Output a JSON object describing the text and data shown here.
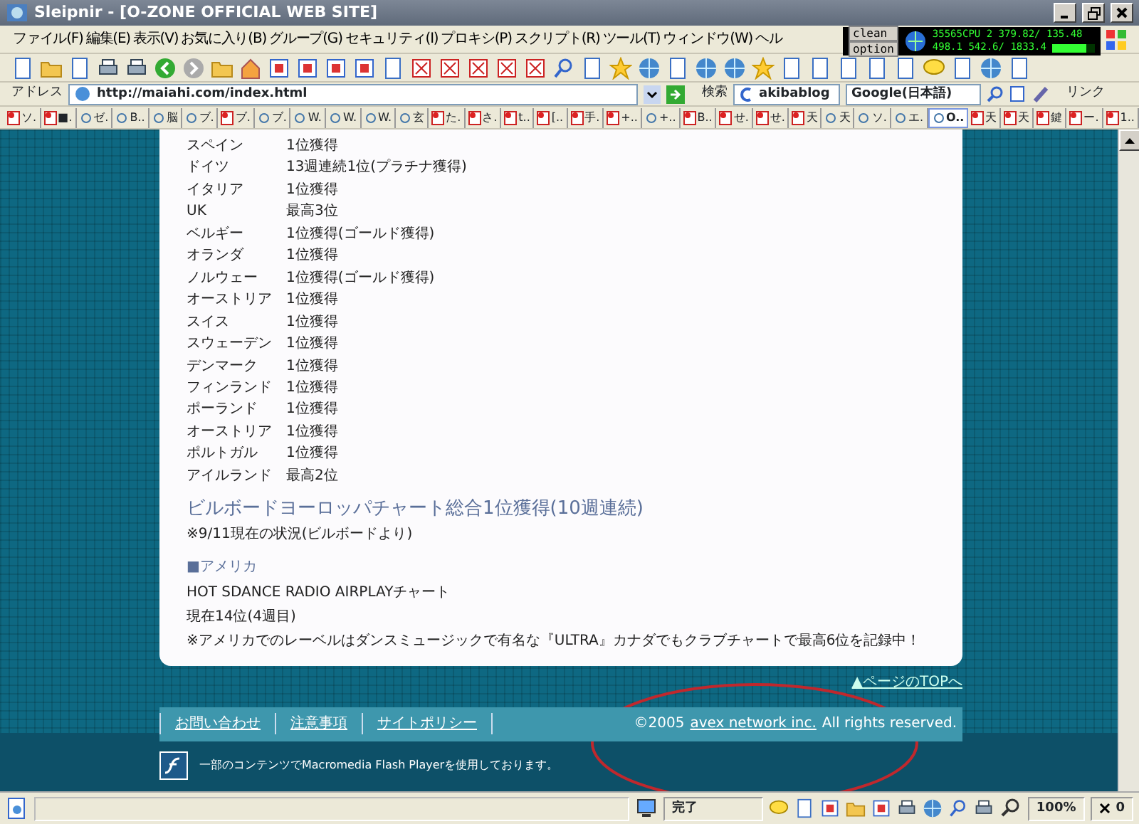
{
  "window": {
    "title": "Sleipnir - [O-ZONE OFFICIAL WEB SITE]"
  },
  "menu": [
    "ファイル(F)",
    "編集(E)",
    "表示(V)",
    "お気に入り(B)",
    "グループ(G)",
    "セキュリティ(I)",
    "プロキシ(P)",
    "スクリプト(R)",
    "ツール(T)",
    "ウィンドウ(W)",
    "ヘル"
  ],
  "cpu_monitor": {
    "buttons": [
      "clean",
      "option"
    ],
    "lines": [
      "35565CPU 2 379.82/ 135.48",
      "498.1 542.6/ 1833.4"
    ],
    "level": 0.8
  },
  "address": {
    "label": "アドレス",
    "url": "http://maiahi.com/index.html"
  },
  "search": {
    "label": "検索",
    "query": "akibablog",
    "engine": "Google(日本語)"
  },
  "links_label": "リンク",
  "tabs": [
    {
      "label": "ソ.",
      "kind": "page",
      "selected": false
    },
    {
      "label": "■.",
      "kind": "page",
      "selected": false
    },
    {
      "label": "ゼ.",
      "kind": "dot",
      "selected": false
    },
    {
      "label": "B..",
      "kind": "dot",
      "selected": false
    },
    {
      "label": "脳",
      "kind": "dot",
      "selected": false
    },
    {
      "label": "ブ.",
      "kind": "dot",
      "selected": false
    },
    {
      "label": "ブ.",
      "kind": "page",
      "selected": false
    },
    {
      "label": "ブ.",
      "kind": "dot",
      "selected": false
    },
    {
      "label": "W.",
      "kind": "dot",
      "selected": false
    },
    {
      "label": "W.",
      "kind": "dot",
      "selected": false
    },
    {
      "label": "W.",
      "kind": "dot",
      "selected": false
    },
    {
      "label": "玄",
      "kind": "dot",
      "selected": false
    },
    {
      "label": "た.",
      "kind": "page",
      "selected": false
    },
    {
      "label": "さ.",
      "kind": "page",
      "selected": false
    },
    {
      "label": "t..",
      "kind": "page",
      "selected": false
    },
    {
      "label": "[..",
      "kind": "page",
      "selected": false
    },
    {
      "label": "手.",
      "kind": "page",
      "selected": false
    },
    {
      "label": "+..",
      "kind": "page",
      "selected": false
    },
    {
      "label": "+..",
      "kind": "dot",
      "selected": false
    },
    {
      "label": "B..",
      "kind": "page",
      "selected": false
    },
    {
      "label": "せ.",
      "kind": "page",
      "selected": false
    },
    {
      "label": "せ.",
      "kind": "page",
      "selected": false
    },
    {
      "label": "天",
      "kind": "page",
      "selected": false
    },
    {
      "label": "天",
      "kind": "dot",
      "selected": false
    },
    {
      "label": "ソ.",
      "kind": "dot",
      "selected": false
    },
    {
      "label": "エ.",
      "kind": "dot",
      "selected": false
    },
    {
      "label": "O..",
      "kind": "dot",
      "selected": true
    },
    {
      "label": "天",
      "kind": "page",
      "selected": false
    },
    {
      "label": "天",
      "kind": "page",
      "selected": false
    },
    {
      "label": "鍵",
      "kind": "page",
      "selected": false
    },
    {
      "label": "ー.",
      "kind": "page",
      "selected": false
    },
    {
      "label": "1..",
      "kind": "page",
      "selected": false
    }
  ],
  "page": {
    "chart_rows": [
      {
        "country": "スペイン",
        "result": "1位獲得"
      },
      {
        "country": "ドイツ",
        "result": "13週連続1位(プラチナ獲得)"
      },
      {
        "country": "イタリア",
        "result": "1位獲得"
      },
      {
        "country": "UK",
        "result": "最高3位"
      },
      {
        "country": "ベルギー",
        "result": "1位獲得(ゴールド獲得)"
      },
      {
        "country": "オランダ",
        "result": "1位獲得"
      },
      {
        "country": "ノルウェー",
        "result": "1位獲得(ゴールド獲得)"
      },
      {
        "country": "オーストリア",
        "result": "1位獲得"
      },
      {
        "country": "スイス",
        "result": "1位獲得"
      },
      {
        "country": "スウェーデン",
        "result": "1位獲得"
      },
      {
        "country": "デンマーク",
        "result": "1位獲得"
      },
      {
        "country": "フィンランド",
        "result": "1位獲得"
      },
      {
        "country": "ポーランド",
        "result": "1位獲得"
      },
      {
        "country": "オーストリア",
        "result": "1位獲得"
      },
      {
        "country": "ポルトガル",
        "result": "1位獲得"
      },
      {
        "country": "アイルランド",
        "result": "最高2位"
      }
    ],
    "headline": "ビルボードヨーロッパチャート総合1位獲得(10週連続)",
    "note": "※9/11現在の状況(ビルボードより)",
    "section_title": "■アメリカ",
    "lines": [
      "HOT SDANCE RADIO AIRPLAYチャート",
      "現在14位(4週目)",
      "※アメリカでのレーベルはダンスミュージックで有名な『ULTRA』カナダでもクラブチャートで最高6位を記録中！"
    ],
    "top_link": "▲ページのTOPへ",
    "footer_links": [
      "お問い合わせ",
      "注意事項",
      "サイトポリシー"
    ],
    "copyright": {
      "prefix": "©2005",
      "link": "avex network inc.",
      "suffix": "All rights reserved."
    },
    "flash_notice": "一部のコンテンツでMacromedia Flash Playerを使用しております。"
  },
  "status_bar": {
    "state": "完了",
    "zoom": "100%",
    "count": "0"
  }
}
